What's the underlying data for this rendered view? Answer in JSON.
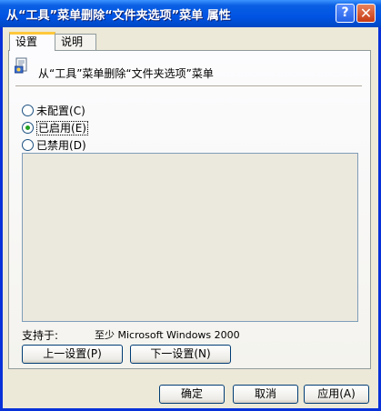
{
  "window": {
    "title": "从“工具”菜单删除“文件夹选项”菜单 属性",
    "help_glyph": "?",
    "close_glyph": "✕"
  },
  "tabs": [
    {
      "label": "设置",
      "active": true
    },
    {
      "label": "说明",
      "active": false
    }
  ],
  "policy": {
    "icon": "policy-document-icon",
    "title": "从“工具”菜单删除“文件夹选项”菜单"
  },
  "options": [
    {
      "label": "未配置",
      "key": "(C)",
      "selected": false
    },
    {
      "label": "已启用",
      "key": "(E)",
      "selected": true
    },
    {
      "label": "已禁用",
      "key": "(D)",
      "selected": false
    }
  ],
  "support": {
    "label": "支持于:",
    "value": "至少 Microsoft Windows 2000"
  },
  "nav_buttons": {
    "prev": "上一设置(P)",
    "next": "下一设置(N)"
  },
  "dialog_buttons": {
    "ok": "确定",
    "cancel": "取消",
    "apply": "应用(A)"
  },
  "colors": {
    "titlebar": "#0054e3",
    "dialog_bg": "#ece9d8",
    "tab_highlight": "#ffc83c",
    "radio_dot": "#21a121"
  }
}
